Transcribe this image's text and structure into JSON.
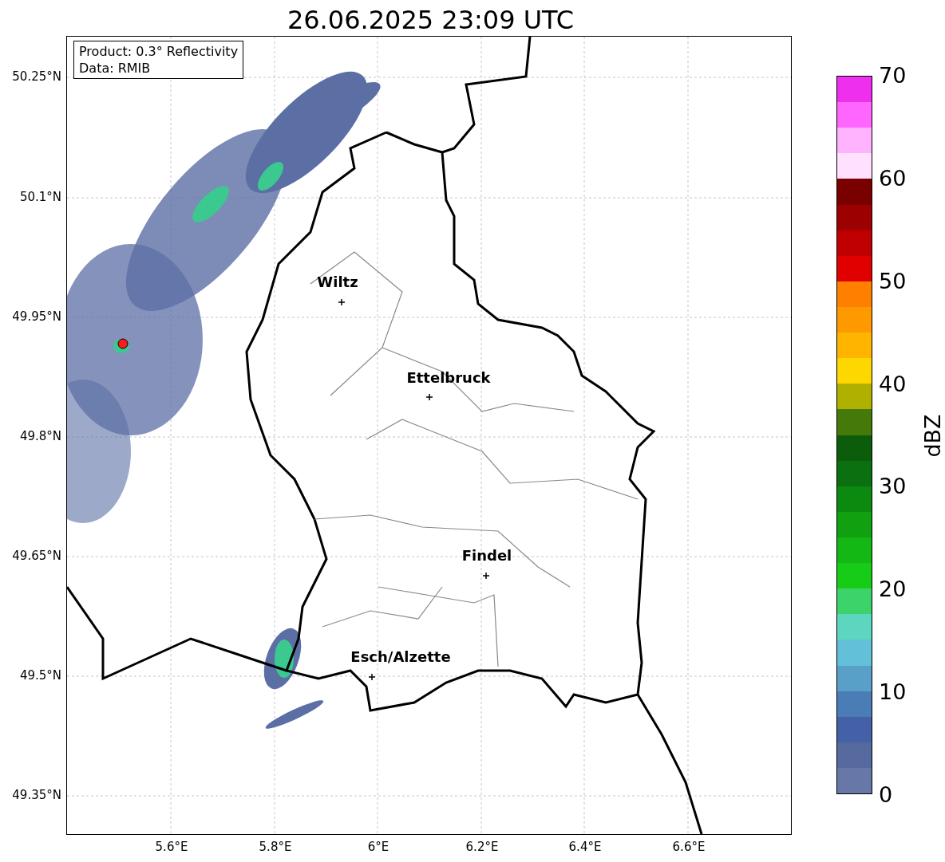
{
  "title": "26.06.2025 23:09 UTC",
  "info_box": [
    "Product: 0.3° Reflectivity",
    "Data: RMIB"
  ],
  "map": {
    "cities": [
      {
        "name": "Wiltz"
      },
      {
        "name": "Ettelbruck"
      },
      {
        "name": "Findel"
      },
      {
        "name": "Esch/Alzette"
      }
    ]
  },
  "lat_ticks": [
    "50.25°N",
    "50.1°N",
    "49.95°N",
    "49.8°N",
    "49.65°N",
    "49.5°N",
    "49.35°N"
  ],
  "lon_ticks": [
    "5.6°E",
    "5.8°E",
    "6°E",
    "6.2°E",
    "6.4°E",
    "6.6°E"
  ],
  "colorbar": {
    "label": "dBZ",
    "ticks": [
      "70",
      "60",
      "50",
      "40",
      "30",
      "20",
      "10",
      "0"
    ],
    "colors": [
      {
        "color": "#ee30ee"
      },
      {
        "color": "#ff66ff"
      },
      {
        "color": "#ffb3ff"
      },
      {
        "color": "#ffe0ff"
      },
      {
        "color": "#7a0000"
      },
      {
        "color": "#9c0000"
      },
      {
        "color": "#c00000"
      },
      {
        "color": "#e00000"
      },
      {
        "color": "#ff7f00"
      },
      {
        "color": "#ff9900"
      },
      {
        "color": "#ffb400"
      },
      {
        "color": "#ffd700"
      },
      {
        "color": "#b0b000"
      },
      {
        "color": "#457a0a"
      },
      {
        "color": "#0b5c0b"
      },
      {
        "color": "#0a7010"
      },
      {
        "color": "#0c8a10"
      },
      {
        "color": "#10a010"
      },
      {
        "color": "#14b814"
      },
      {
        "color": "#16cc16"
      },
      {
        "color": "#3dd36b"
      },
      {
        "color": "#5dd6c0"
      },
      {
        "color": "#62c1d8"
      },
      {
        "color": "#58a0c8"
      },
      {
        "color": "#4a7cb6"
      },
      {
        "color": "#4460a6"
      },
      {
        "color": "#566aa0"
      },
      {
        "color": "#6677a8"
      }
    ]
  }
}
